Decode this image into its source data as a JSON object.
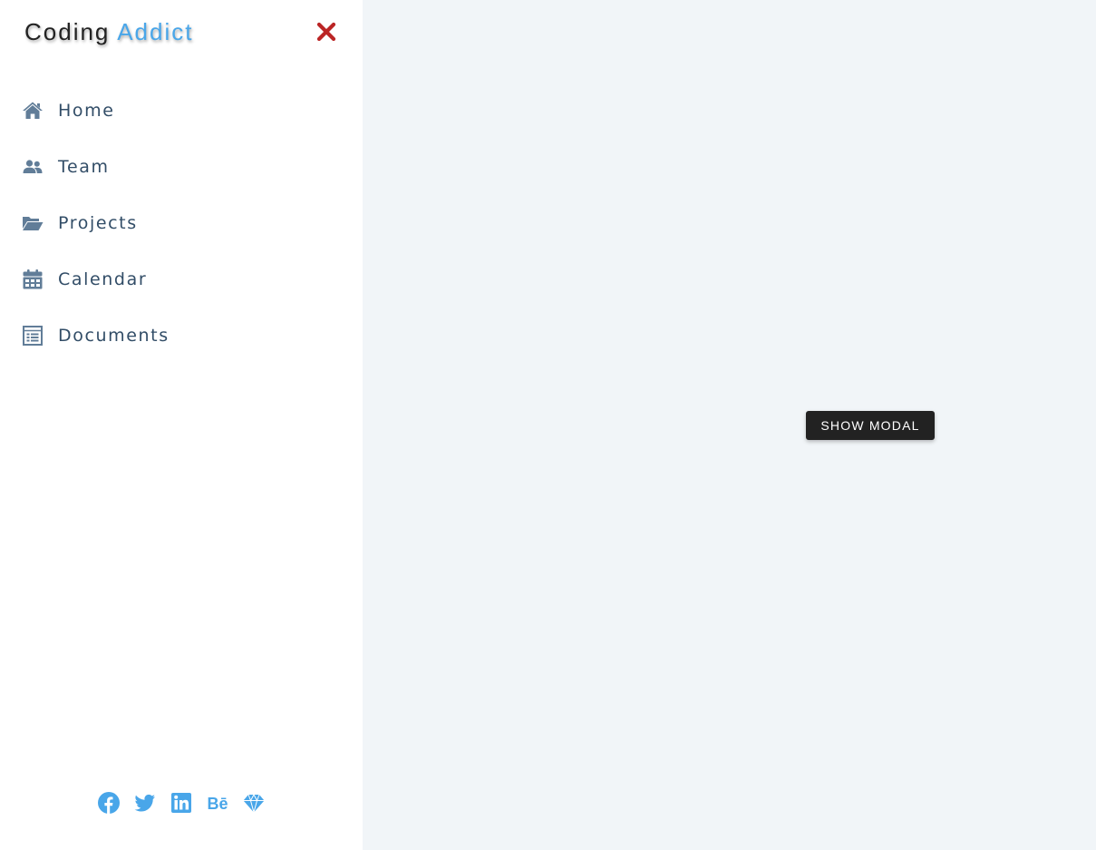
{
  "sidebar": {
    "logo": {
      "part_a": "Coding",
      "part_b": "Addict"
    },
    "close_icon": "close-icon",
    "nav_items": [
      {
        "label": "Home",
        "icon": "home-icon"
      },
      {
        "label": "Team",
        "icon": "users-icon"
      },
      {
        "label": "Projects",
        "icon": "folder-open-icon"
      },
      {
        "label": "Calendar",
        "icon": "calendar-icon"
      },
      {
        "label": "Documents",
        "icon": "document-icon"
      }
    ],
    "social_links": [
      {
        "icon": "facebook-icon"
      },
      {
        "icon": "twitter-icon"
      },
      {
        "icon": "linkedin-icon"
      },
      {
        "icon": "behance-icon",
        "text": "Bē"
      },
      {
        "icon": "sketch-icon"
      }
    ]
  },
  "main": {
    "button_label": "Show Modal"
  },
  "colors": {
    "accent": "#49a6e9",
    "close": "#bb2525",
    "nav_text": "#324d67",
    "nav_icon": "#617d98",
    "main_bg": "#f1f5f8",
    "button_bg": "#222222"
  }
}
